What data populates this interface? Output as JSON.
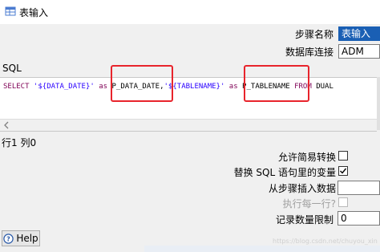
{
  "window": {
    "title": "表输入"
  },
  "fields": {
    "step_name_label": "步骤名称",
    "step_name_value": "表输入",
    "connection_label": "数据库连接",
    "connection_value": "ADM"
  },
  "sql_section": {
    "label": "SQL",
    "code_parts": {
      "select": "SELECT",
      "arg1": " '${DATA_DATE}' ",
      "as1": "as",
      "alias1": " P_DATA_DATE,",
      "arg2": "'${TABLENAME}' ",
      "as2": "as",
      "alias2": " P_TABLENAME ",
      "from": "FROM",
      "table": " DUAL"
    },
    "cursor_position": "行1 列0"
  },
  "options": {
    "lazy_conversion_label": "允许简易转换",
    "lazy_conversion_checked": false,
    "replace_variables_label": "替换 SQL 语句里的变量",
    "replace_variables_checked": true,
    "insert_from_step_label": "从步骤插入数据",
    "execute_each_row_label": "执行每一行?",
    "execute_each_row_checked": false,
    "limit_label": "记录数量限制",
    "limit_value": "0"
  },
  "footer": {
    "help_label": "Help",
    "watermark": "https://blog.csdn.net/chuyou_xin"
  },
  "colors": {
    "highlight_border": "#e8242c",
    "selection": "#1a5fb4"
  },
  "icons": {
    "window": "table-input-icon",
    "help": "help-icon",
    "check": "check-icon"
  }
}
